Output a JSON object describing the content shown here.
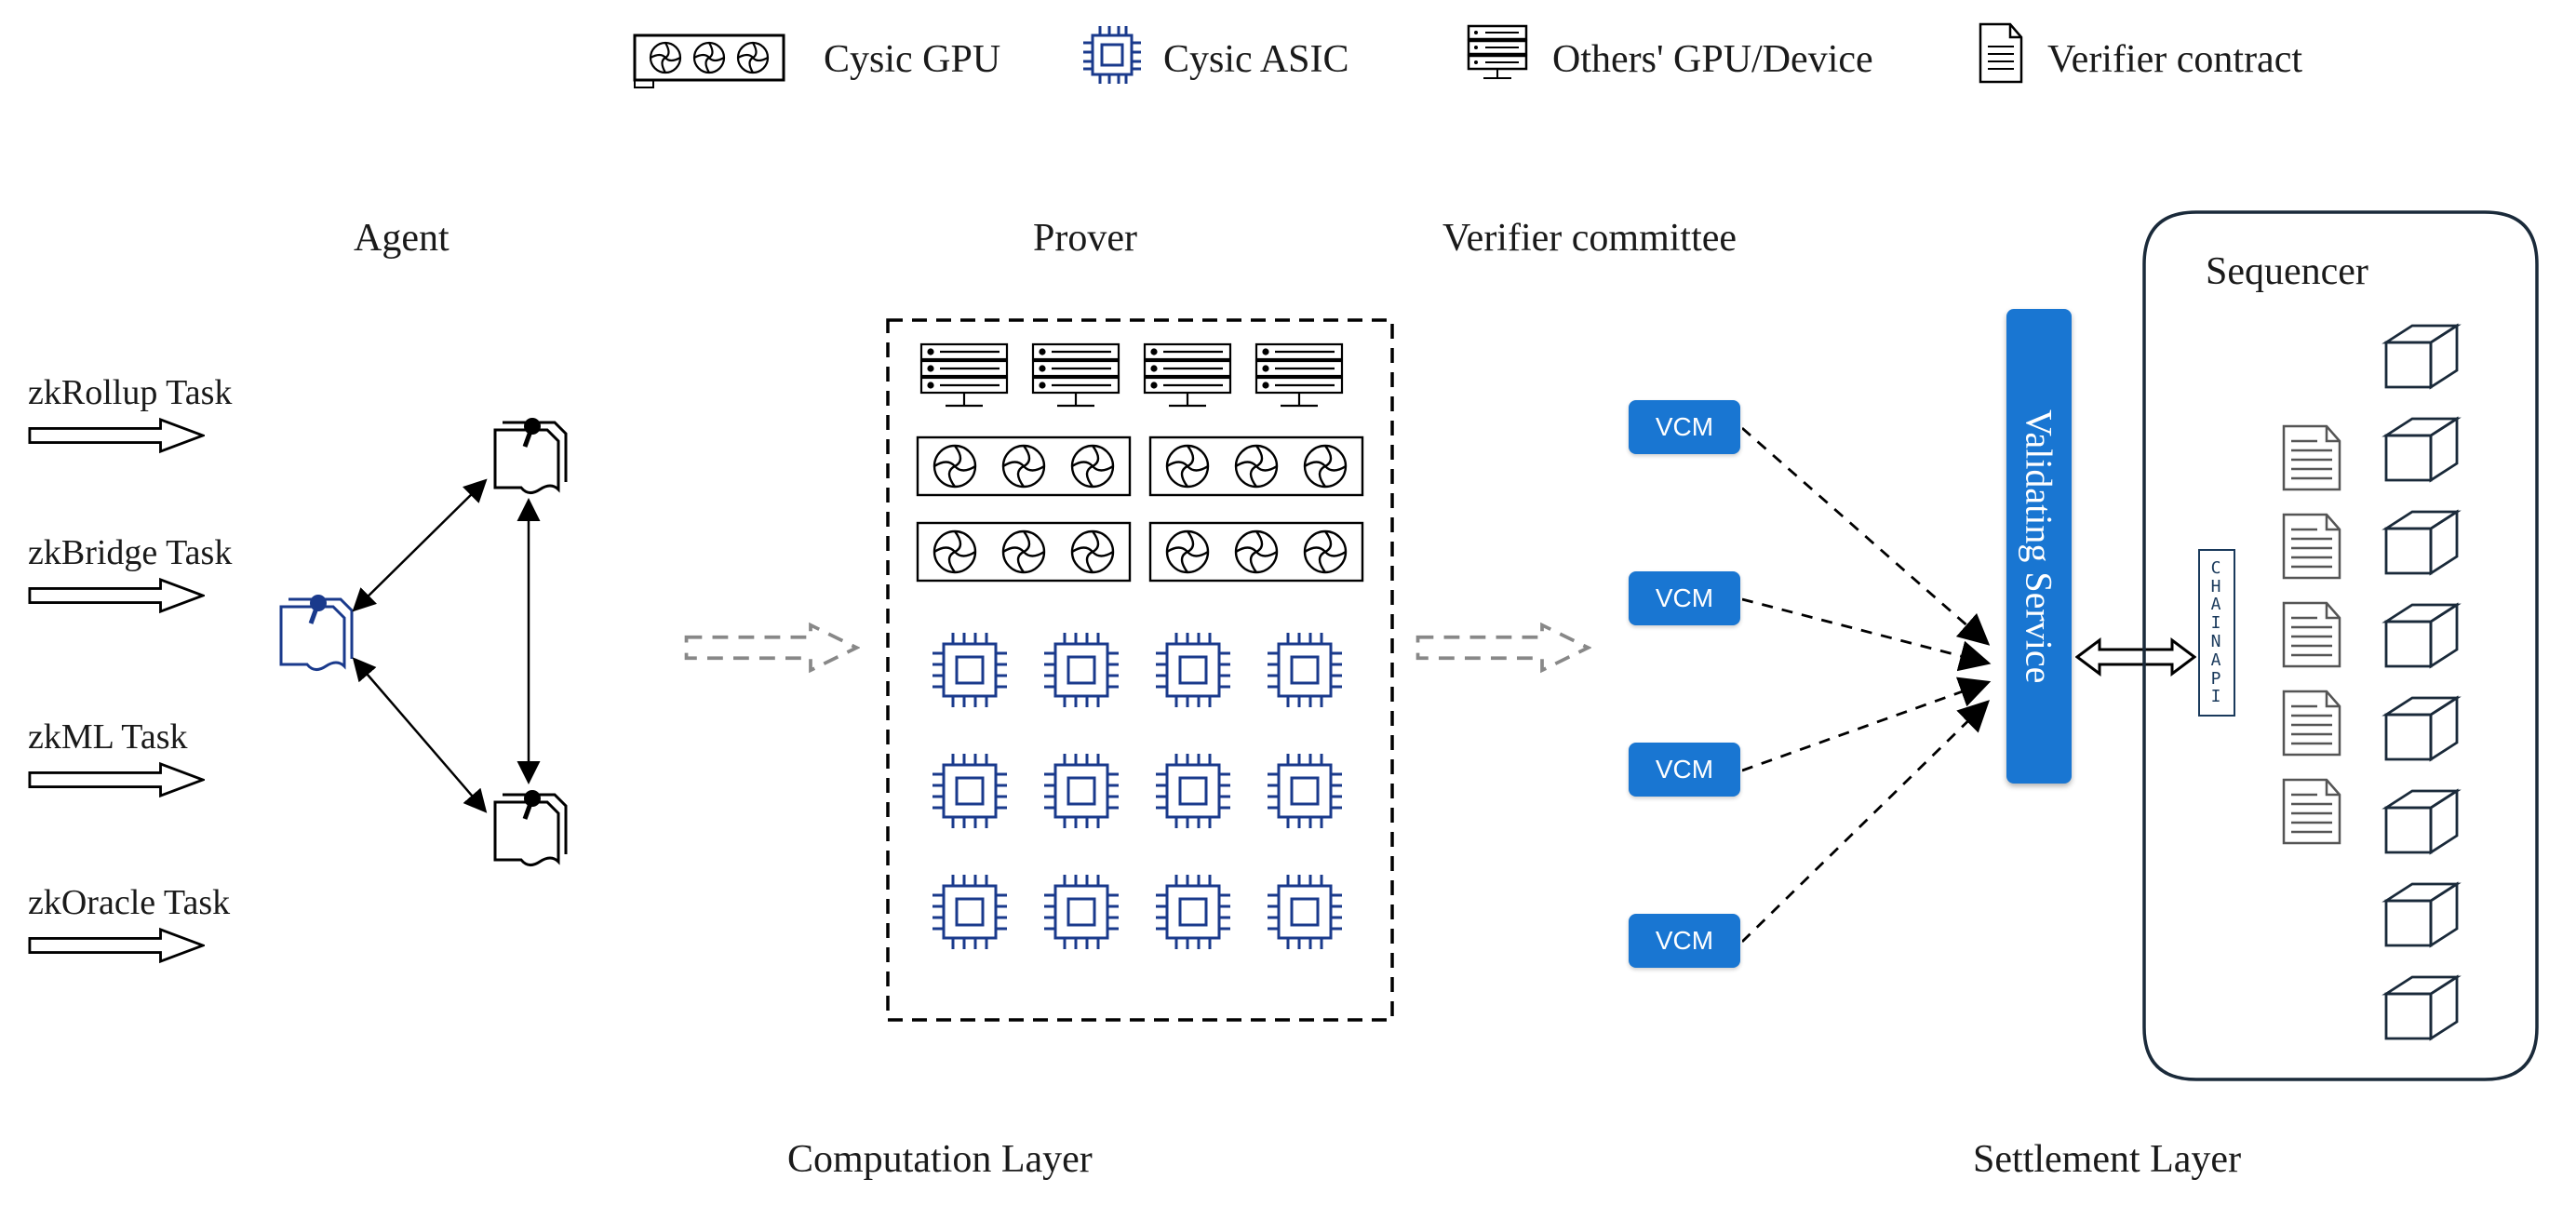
{
  "legend": {
    "gpu": "Cysic GPU",
    "asic": "Cysic ASIC",
    "others": "Others' GPU/Device",
    "verifier": "Verifier contract"
  },
  "columns": {
    "agent": "Agent",
    "prover": "Prover",
    "verifier": "Verifier committee",
    "sequencer": "Sequencer"
  },
  "tasks": [
    "zkRollup Task",
    "zkBridge Task",
    "zkML Task",
    "zkOracle Task"
  ],
  "vcm_label": "VCM",
  "validating": "Validating Service",
  "chainapi": "CHAINAPI",
  "layers": {
    "computation": "Computation Layer",
    "settlement": "Settlement Layer"
  }
}
